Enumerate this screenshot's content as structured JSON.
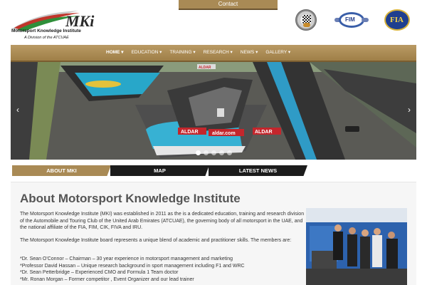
{
  "header": {
    "contact_label": "Contact",
    "logo": {
      "mark_text": "MKi",
      "title": "Motorsport Knowledge Institute",
      "subtitle": "A Division of the ATCUAE"
    },
    "partner_logos": [
      {
        "name": "checkered-flag-logo",
        "text": ""
      },
      {
        "name": "fim-logo",
        "text": "FIM"
      },
      {
        "name": "fia-logo",
        "text": "FIA"
      }
    ]
  },
  "nav": {
    "items": [
      {
        "label": "HOME ▾",
        "active": true
      },
      {
        "label": "EDUCATION ▾"
      },
      {
        "label": "TRAINING ▾"
      },
      {
        "label": "RESEARCH ▾"
      },
      {
        "label": "NEWS ▾"
      },
      {
        "label": "GALLERY ▾"
      }
    ]
  },
  "slider": {
    "signage": [
      "ALDAR",
      "aldar.com",
      "ALDAR",
      "ALDAR"
    ],
    "prev_icon": "chevron-left-icon",
    "next_icon": "chevron-right-icon",
    "dot_count": 5,
    "active_dot": 0
  },
  "tabs": [
    {
      "label": "ABOUT MKI",
      "active": true
    },
    {
      "label": "MAP"
    },
    {
      "label": "LATEST NEWS"
    }
  ],
  "content": {
    "heading": "About Motorsport Knowledge Institute",
    "para1": "The Motorsport Knowledge Institute (MKI) was established in 2011 as the is a dedicated education, training and research division of the Automobile and Touring Club of the United Arab Emirates (ATCUAE), the governing body of all motorsport in the UAE, and the national affiliate of the FIA, FIM, CIK, FIVA and IRU.",
    "para2": "The Motorsport Knowledge Institute board represents a unique blend of academic and practitioner skills. The members are:",
    "members": [
      "*Dr. Sean O'Connor – Chairman – 30 year experience in motorsport management and marketing",
      "*Professor David Hassan – Unique research background in sport management including F1 and WRC",
      "*Dr. Sean Petterbridge – Experienced CMO and Formula 1 Team doctor",
      "*Mr. Ronan Morgan – Former competitor , Event Organizer and our lead trainer"
    ]
  },
  "colors": {
    "gold": "#a98a55",
    "dark": "#1c1c1c",
    "content_bg": "#f6f6f6"
  }
}
